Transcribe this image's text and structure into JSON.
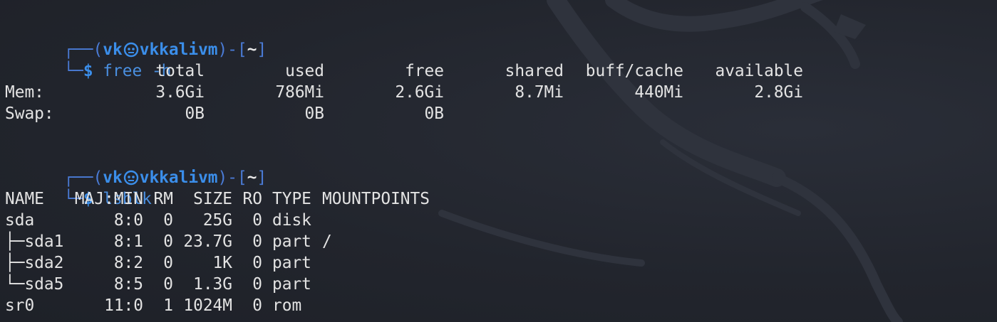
{
  "prompt": {
    "user": "vk",
    "host": "vkkalivm",
    "cwd": "~",
    "symbol": "$"
  },
  "commands": [
    "free -h",
    "lsblk"
  ],
  "free": {
    "headers": [
      "total",
      "used",
      "free",
      "shared",
      "buff/cache",
      "available"
    ],
    "rows": [
      {
        "label": "Mem:",
        "values": [
          "3.6Gi",
          "786Mi",
          "2.6Gi",
          "8.7Mi",
          "440Mi",
          "2.8Gi"
        ]
      },
      {
        "label": "Swap:",
        "values": [
          "0B",
          "0B",
          "0B",
          "",
          "",
          ""
        ]
      }
    ]
  },
  "lsblk": {
    "headers": [
      "NAME",
      "MAJ:MIN",
      "RM",
      "SIZE",
      "RO",
      "TYPE",
      "MOUNTPOINTS"
    ],
    "rows": [
      [
        "sda",
        "8:0",
        "0",
        "25G",
        "0",
        "disk",
        ""
      ],
      [
        "├─sda1",
        "8:1",
        "0",
        "23.7G",
        "0",
        "part",
        "/"
      ],
      [
        "├─sda2",
        "8:2",
        "0",
        "1K",
        "0",
        "part",
        ""
      ],
      [
        "└─sda5",
        "8:5",
        "0",
        "1.3G",
        "0",
        "part",
        ""
      ],
      [
        "sr0",
        "11:0",
        "1",
        "1024M",
        "0",
        "rom",
        ""
      ]
    ]
  },
  "colors": {
    "background": "#22252d",
    "prompt_box": "#4a7bd6",
    "prompt_user": "#3b8eea",
    "command": "#4a8fe0",
    "output": "#e3e3e3"
  },
  "icons": {
    "prompt_separator": "kali-skull-icon",
    "background": "kali-dragon-watermark"
  }
}
